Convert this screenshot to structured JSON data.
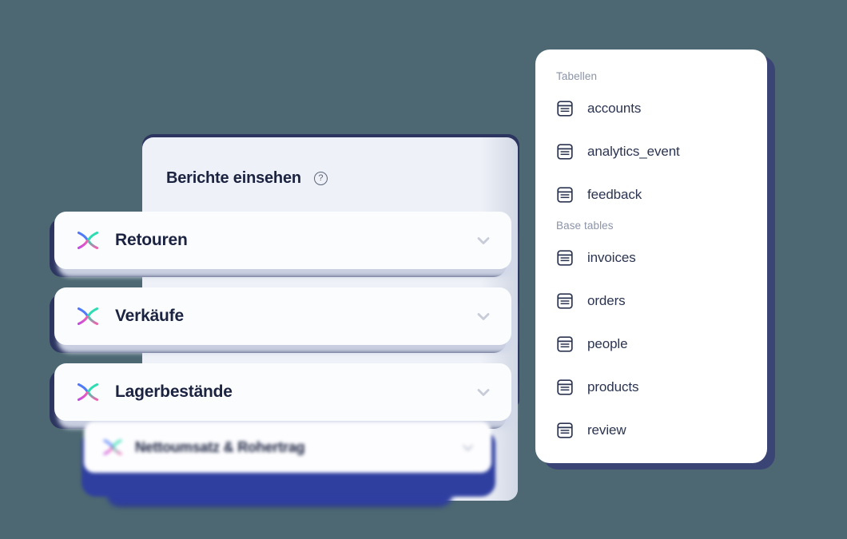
{
  "theme": {
    "background": "#4d6872",
    "panel_bg": "#eef1f7",
    "card_bg": "#fbfcfe",
    "navy_accent": "#2b3560",
    "blue_accent": "#2f3fa0",
    "text_dark": "#1b2340",
    "text_muted": "#8b93a7",
    "chevron": "#c8ccd8"
  },
  "panel": {
    "title": "Berichte einsehen",
    "help_icon_glyph": "?",
    "help_icon_name": "question-mark-circle-icon"
  },
  "cards": [
    {
      "id": "retouren",
      "label": "Retouren",
      "icon": "brand-x-logo",
      "chevron": "chevron-down-icon"
    },
    {
      "id": "verkaeufe",
      "label": "Verkäufe",
      "icon": "brand-x-logo",
      "chevron": "chevron-down-icon"
    },
    {
      "id": "lager",
      "label": "Lagerbestände",
      "icon": "brand-x-logo",
      "chevron": "chevron-down-icon"
    },
    {
      "id": "netto",
      "label": "Nettoumsatz & Rohertrag",
      "icon": "brand-x-logo",
      "chevron": "chevron-down-icon"
    }
  ],
  "ghost_row": {
    "label": "Nettoumsatz & Rohertrag"
  },
  "dropdown": {
    "groups": [
      {
        "label": "Tabellen",
        "items": [
          {
            "label": "accounts",
            "icon": "table-icon"
          },
          {
            "label": "analytics_event",
            "icon": "table-icon"
          },
          {
            "label": "feedback",
            "icon": "table-icon"
          }
        ]
      },
      {
        "label": "Base tables",
        "items": [
          {
            "label": "invoices",
            "icon": "table-icon"
          },
          {
            "label": "orders",
            "icon": "table-icon"
          },
          {
            "label": "people",
            "icon": "table-icon"
          },
          {
            "label": "products",
            "icon": "table-icon"
          },
          {
            "label": "review",
            "icon": "table-icon"
          }
        ]
      }
    ]
  }
}
